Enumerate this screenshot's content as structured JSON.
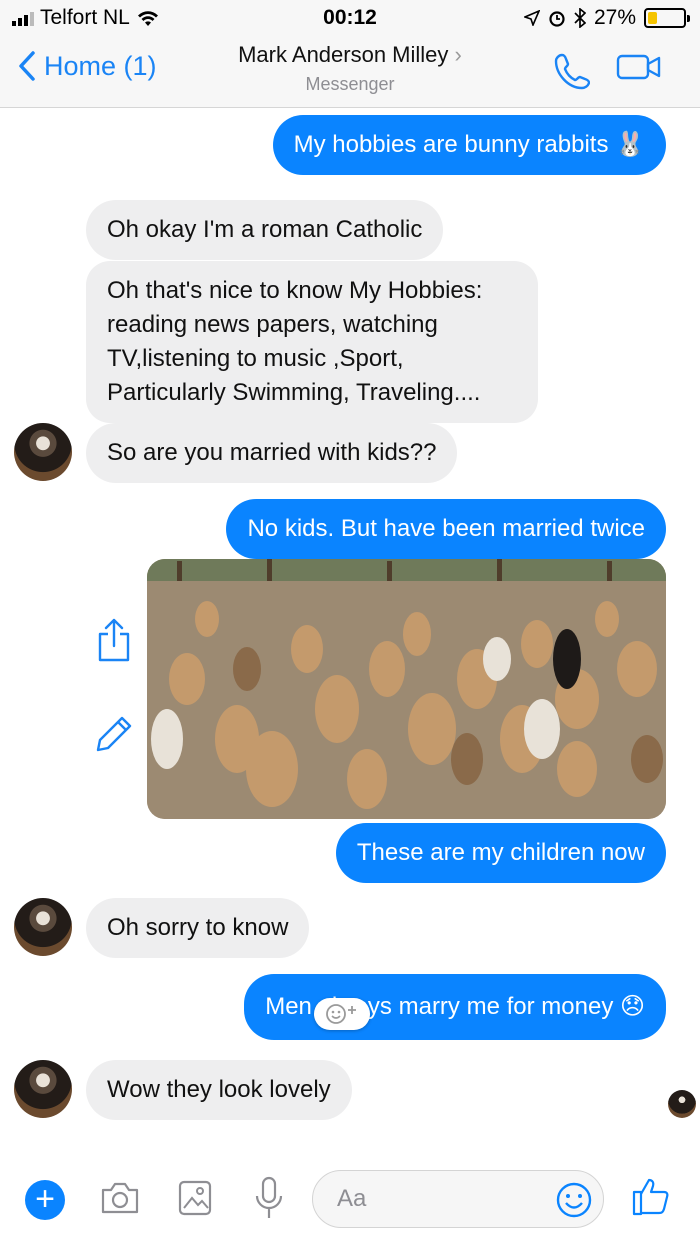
{
  "status_bar": {
    "carrier": "Telfort NL",
    "time": "00:12",
    "battery": "27%",
    "battery_level": 0.27
  },
  "header": {
    "back_label": "Home (1)",
    "contact_name": "Mark Anderson Milley",
    "subtitle": "Messenger"
  },
  "messages": [
    {
      "side": "out",
      "text": "My hobbies are bunny rabbits 🐰"
    },
    {
      "side": "in",
      "text": "Oh okay I'm a roman Catholic"
    },
    {
      "side": "in",
      "text": "Oh that's nice to know My Hobbies: reading news papers, watching TV,listening to music ,Sport, Particularly Swimming, Traveling...."
    },
    {
      "side": "in",
      "text": "So are you married with kids??"
    },
    {
      "side": "out",
      "text": "No kids. But have been married twice"
    },
    {
      "side": "out",
      "text": "These are my children now"
    },
    {
      "side": "in",
      "text": "Oh sorry to know"
    },
    {
      "side": "out",
      "text": "Men always marry me for money 😞"
    },
    {
      "side": "in",
      "text": "Wow they look lovely"
    }
  ],
  "composer": {
    "placeholder": "Aa"
  },
  "colors": {
    "accent": "#0a84ff",
    "incoming_bubble": "#eeeeef",
    "back_text": "#1a84f5"
  }
}
